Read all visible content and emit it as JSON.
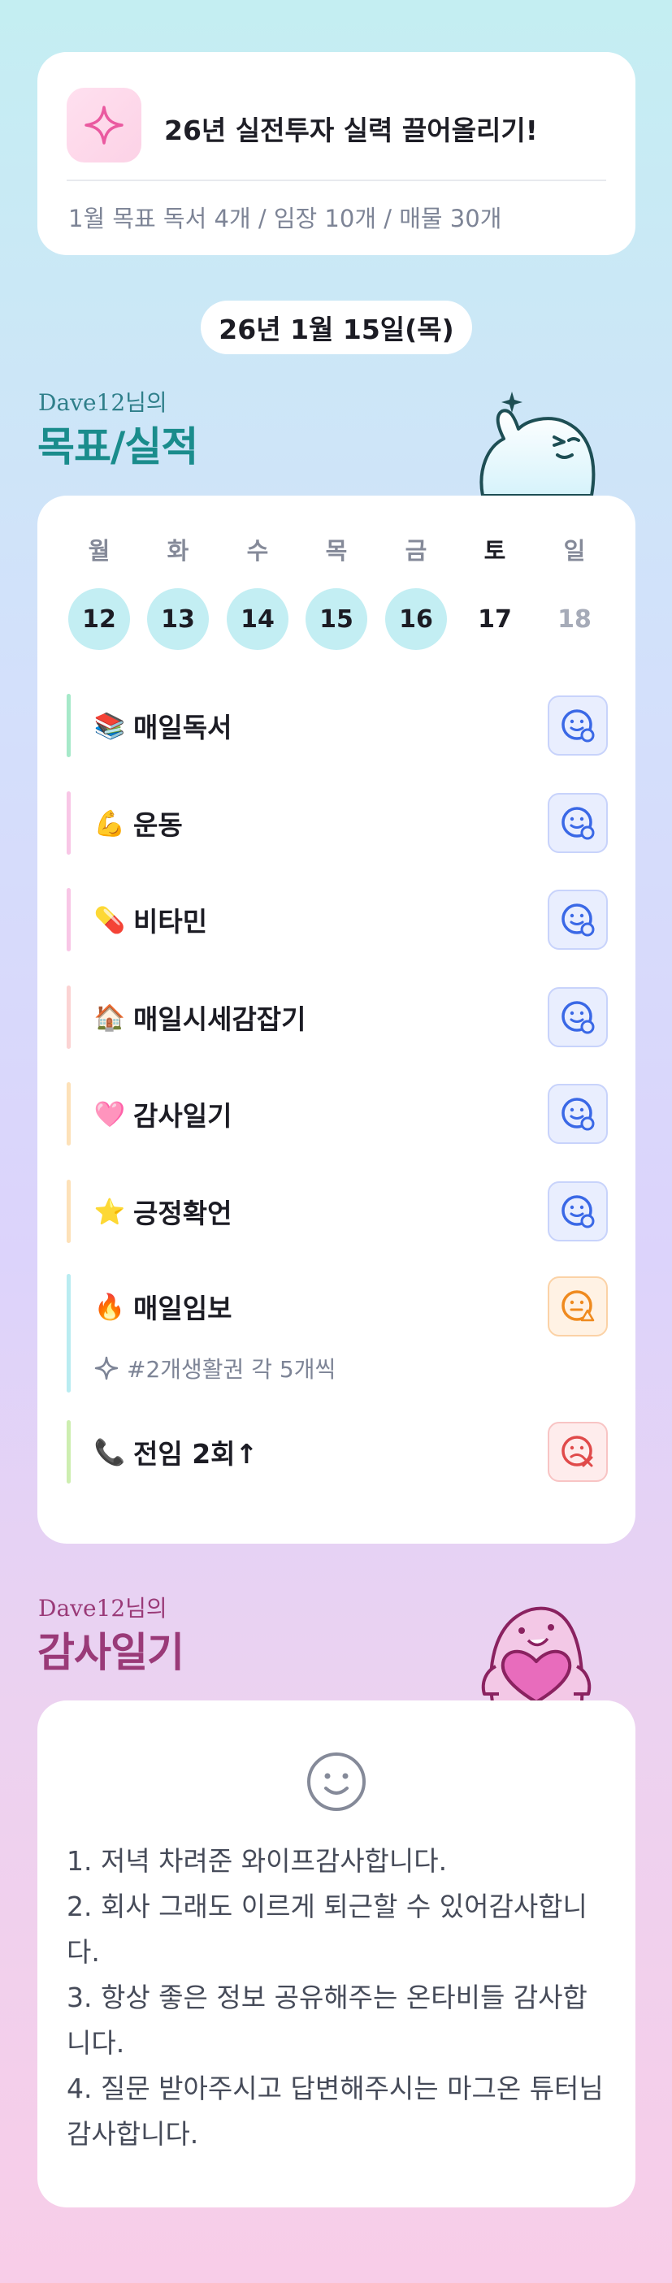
{
  "goal": {
    "title": "26년 실전투자 실력 끌어올리기!",
    "subtitle": "1월 목표  독서 4개 / 임장 10개 / 매물 30개",
    "icon": "sparkle-icon"
  },
  "date": "26년 1월 15일(목)",
  "progress_section": {
    "user": "Dave12님의",
    "title": "목표/실적",
    "title_color": "#1a8c8c"
  },
  "week": [
    {
      "label": "월",
      "num": "12",
      "state": "done"
    },
    {
      "label": "화",
      "num": "13",
      "state": "done"
    },
    {
      "label": "수",
      "num": "14",
      "state": "done"
    },
    {
      "label": "목",
      "num": "15",
      "state": "done"
    },
    {
      "label": "금",
      "num": "16",
      "state": "done"
    },
    {
      "label": "토",
      "num": "17",
      "state": "plain"
    },
    {
      "label": "일",
      "num": "18",
      "state": "future"
    }
  ],
  "habits": [
    {
      "emoji": "📚",
      "label": "매일독서",
      "bar_color": "#a6e9c9",
      "status": "done"
    },
    {
      "emoji": "💪",
      "label": "운동",
      "bar_color": "#f8c6e6",
      "status": "done"
    },
    {
      "emoji": "💊",
      "label": "비타민",
      "bar_color": "#f8c6e6",
      "status": "done"
    },
    {
      "emoji": "🏠",
      "label": "매일시세감잡기",
      "bar_color": "#fbd3d3",
      "status": "done"
    },
    {
      "emoji": "🩷",
      "label": "감사일기",
      "bar_color": "#fde1b8",
      "status": "done"
    },
    {
      "emoji": "⭐",
      "label": "긍정확언",
      "bar_color": "#fde1b8",
      "status": "done"
    },
    {
      "emoji": "🔥",
      "label": "매일임보",
      "bar_color": "#b9ecf1",
      "status": "warning",
      "sub": "#2개생활권 각 5개씩"
    },
    {
      "emoji": "📞",
      "label": "전임 2회↑",
      "bar_color": "#cdeeb0",
      "status": "failed"
    }
  ],
  "gratitude_section": {
    "user": "Dave12님의",
    "title": "감사일기",
    "title_color": "#9a3a78"
  },
  "gratitude": {
    "icon": "smile-icon",
    "lines": [
      "1. 저녁 차려준 와이프감사합니다.",
      "2. 회사 그래도 이르게 퇴근할 수 있어감사합니다.",
      "3. 항상 좋은 정보 공유해주는 온타비들 감사합니다.",
      "4. 질문 받아주시고 답변해주시는 마그온 튜터님 감사합니다."
    ]
  }
}
